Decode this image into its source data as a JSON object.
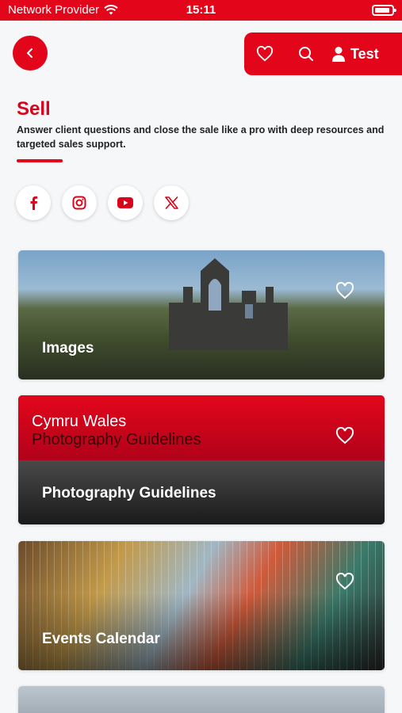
{
  "status_bar": {
    "carrier": "Network Provider",
    "time": "15:11"
  },
  "header": {
    "user_label": "Test"
  },
  "page": {
    "title": "Sell",
    "description": "Answer client questions and close the sale like a pro with deep resources and targeted sales support."
  },
  "socials": [
    "facebook-icon",
    "instagram-icon",
    "youtube-icon",
    "x-icon"
  ],
  "cards": [
    {
      "label": "Images"
    },
    {
      "label": "Photography Guidelines",
      "banner_title": "Cymru Wales",
      "banner_subtitle": "Photography Guidelines"
    },
    {
      "label": "Events Calendar"
    }
  ],
  "colors": {
    "brand_red": "#e3061b",
    "title_red": "#d9041a"
  }
}
